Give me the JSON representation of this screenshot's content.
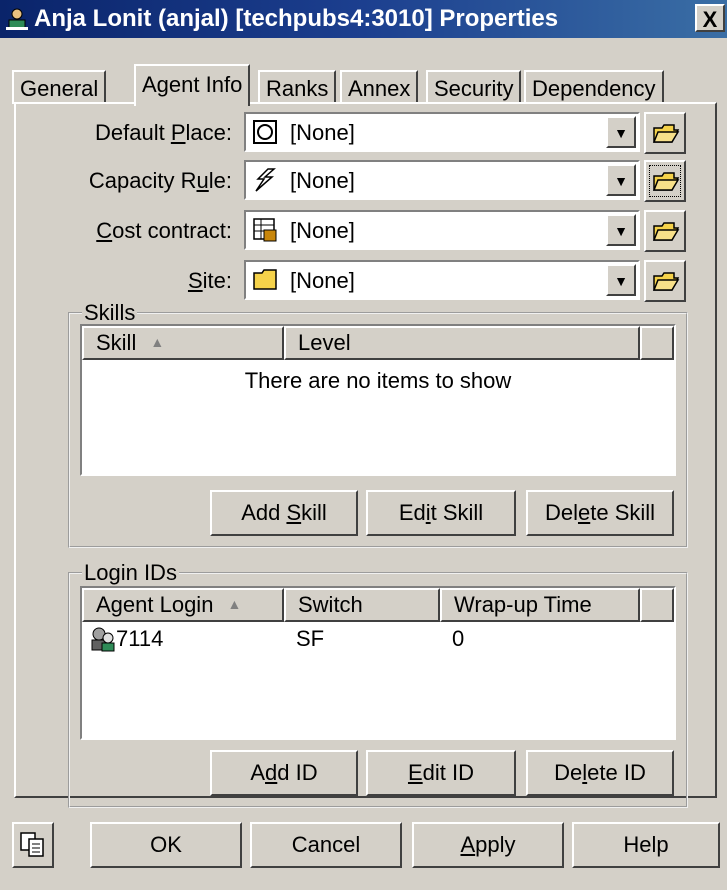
{
  "window": {
    "title": "Anja Lonit (anjal) [techpubs4:3010] Properties",
    "close_label": "X"
  },
  "tabs": [
    {
      "label": "General"
    },
    {
      "label": "Agent Info",
      "active": true
    },
    {
      "label": "Ranks"
    },
    {
      "label": "Annex"
    },
    {
      "label": "Security"
    },
    {
      "label": "Dependency"
    }
  ],
  "fields": {
    "default_place": {
      "label_pre": "Default ",
      "label_u": "P",
      "label_post": "lace:",
      "value": "[None]",
      "icon": "place-icon"
    },
    "capacity_rule": {
      "label_pre": "Capacity R",
      "label_u": "u",
      "label_post": "le:",
      "value": "[None]",
      "icon": "capacity-rule-icon"
    },
    "cost_contract": {
      "label_pre": "",
      "label_u": "C",
      "label_post": "ost contract:",
      "value": "[None]",
      "icon": "cost-contract-icon"
    },
    "site": {
      "label_pre": "",
      "label_u": "S",
      "label_post": "ite:",
      "value": "[None]",
      "icon": "site-folder-icon"
    }
  },
  "skills": {
    "group_title": "Skills",
    "columns": [
      "Skill",
      "Level"
    ],
    "empty_message": "There are no items to show",
    "buttons": {
      "add": {
        "pre": "Add ",
        "u": "S",
        "post": "kill"
      },
      "edit": {
        "pre": "Ed",
        "u": "i",
        "post": "t Skill"
      },
      "delete": {
        "pre": "Del",
        "u": "e",
        "post": "te Skill"
      }
    }
  },
  "login_ids": {
    "group_title": "Login IDs",
    "columns": [
      "Agent Login",
      "Switch",
      "Wrap-up Time"
    ],
    "rows": [
      {
        "agent_login": "7114",
        "switch": "SF",
        "wrap_up_time": "0"
      }
    ],
    "buttons": {
      "add": {
        "pre": "A",
        "u": "d",
        "post": "d ID"
      },
      "edit": {
        "pre": "",
        "u": "E",
        "post": "dit ID"
      },
      "delete": {
        "pre": "De",
        "u": "l",
        "post": "ete ID"
      }
    }
  },
  "footer": {
    "ok": "OK",
    "cancel": "Cancel",
    "apply": {
      "pre": "",
      "u": "A",
      "post": "pply"
    },
    "help": "Help"
  },
  "colors": {
    "face": "#d4d0c8",
    "title_start": "#0a246a",
    "title_end": "#3a6ea5",
    "folder": "#f5d24a"
  }
}
